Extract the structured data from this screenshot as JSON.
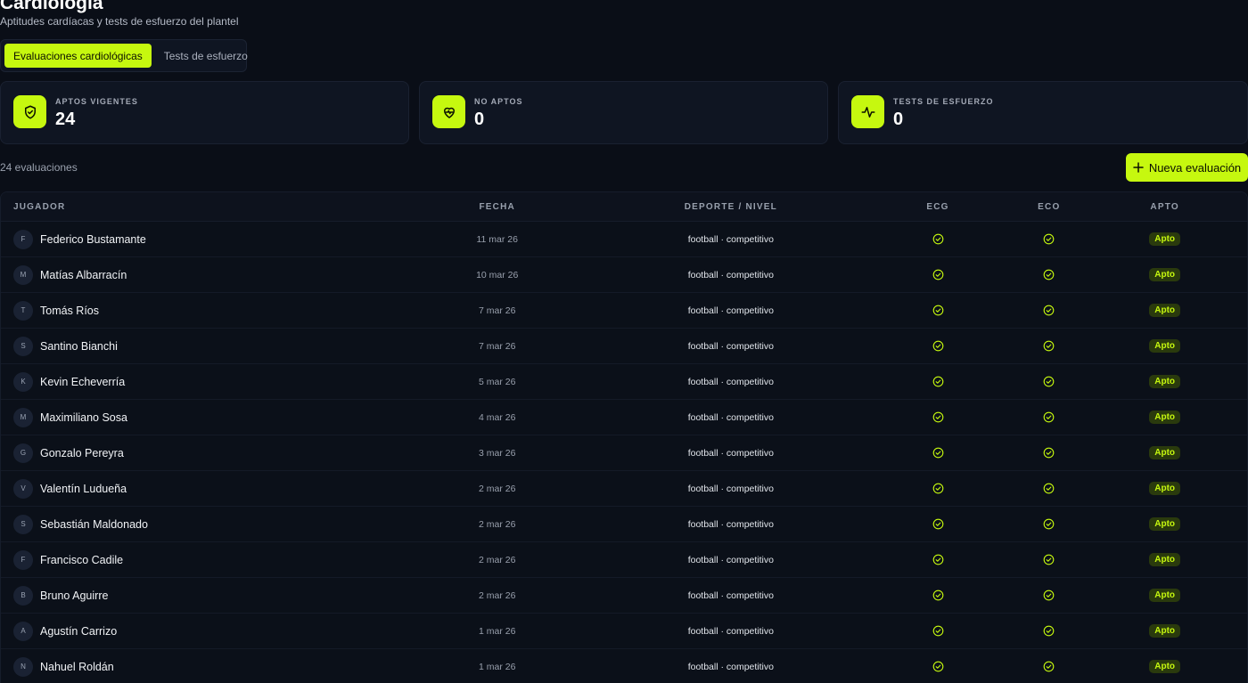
{
  "header": {
    "title": "Cardiología",
    "subtitle": "Aptitudes cardíacas y tests de esfuerzo del plantel"
  },
  "tabs": [
    {
      "label": "Evaluaciones cardiológicas",
      "active": true
    },
    {
      "label": "Tests de esfuerzo",
      "active": false
    }
  ],
  "stats": [
    {
      "label": "APTOS VIGENTES",
      "value": "24",
      "icon": "shield-check-icon"
    },
    {
      "label": "NO APTOS",
      "value": "0",
      "icon": "heart-pulse-icon"
    },
    {
      "label": "TESTS DE ESFUERZO",
      "value": "0",
      "icon": "activity-icon"
    }
  ],
  "list": {
    "count_label": "24 evaluaciones",
    "new_button": "Nueva evaluación"
  },
  "table": {
    "headers": {
      "player": "JUGADOR",
      "date": "FECHA",
      "sport": "DEPORTE / NIVEL",
      "ecg": "ECG",
      "eco": "ECO",
      "apto": "APTO"
    },
    "rows": [
      {
        "initial": "F",
        "name": "Federico Bustamante",
        "date": "11 mar 26",
        "sport": "football · competitivo",
        "ecg": "ok",
        "eco": "ok",
        "apto": "Apto"
      },
      {
        "initial": "M",
        "name": "Matías Albarracín",
        "date": "10 mar 26",
        "sport": "football · competitivo",
        "ecg": "ok",
        "eco": "ok",
        "apto": "Apto"
      },
      {
        "initial": "T",
        "name": "Tomás Ríos",
        "date": "7 mar 26",
        "sport": "football · competitivo",
        "ecg": "ok",
        "eco": "ok",
        "apto": "Apto"
      },
      {
        "initial": "S",
        "name": "Santino Bianchi",
        "date": "7 mar 26",
        "sport": "football · competitivo",
        "ecg": "ok",
        "eco": "ok",
        "apto": "Apto"
      },
      {
        "initial": "K",
        "name": "Kevin Echeverría",
        "date": "5 mar 26",
        "sport": "football · competitivo",
        "ecg": "ok",
        "eco": "ok",
        "apto": "Apto"
      },
      {
        "initial": "M",
        "name": "Maximiliano Sosa",
        "date": "4 mar 26",
        "sport": "football · competitivo",
        "ecg": "ok",
        "eco": "ok",
        "apto": "Apto"
      },
      {
        "initial": "G",
        "name": "Gonzalo Pereyra",
        "date": "3 mar 26",
        "sport": "football · competitivo",
        "ecg": "ok",
        "eco": "ok",
        "apto": "Apto"
      },
      {
        "initial": "V",
        "name": "Valentín Ludueña",
        "date": "2 mar 26",
        "sport": "football · competitivo",
        "ecg": "ok",
        "eco": "ok",
        "apto": "Apto"
      },
      {
        "initial": "S",
        "name": "Sebastián Maldonado",
        "date": "2 mar 26",
        "sport": "football · competitivo",
        "ecg": "ok",
        "eco": "ok",
        "apto": "Apto"
      },
      {
        "initial": "F",
        "name": "Francisco Cadile",
        "date": "2 mar 26",
        "sport": "football · competitivo",
        "ecg": "ok",
        "eco": "ok",
        "apto": "Apto"
      },
      {
        "initial": "B",
        "name": "Bruno Aguirre",
        "date": "2 mar 26",
        "sport": "football · competitivo",
        "ecg": "ok",
        "eco": "ok",
        "apto": "Apto"
      },
      {
        "initial": "A",
        "name": "Agustín Carrizo",
        "date": "1 mar 26",
        "sport": "football · competitivo",
        "ecg": "ok",
        "eco": "ok",
        "apto": "Apto"
      },
      {
        "initial": "N",
        "name": "Nahuel Roldán",
        "date": "1 mar 26",
        "sport": "football · competitivo",
        "ecg": "ok",
        "eco": "ok",
        "apto": "Apto"
      }
    ]
  },
  "colors": {
    "accent": "#c6f80f",
    "background": "#0a0e17",
    "card": "#0f1522"
  }
}
